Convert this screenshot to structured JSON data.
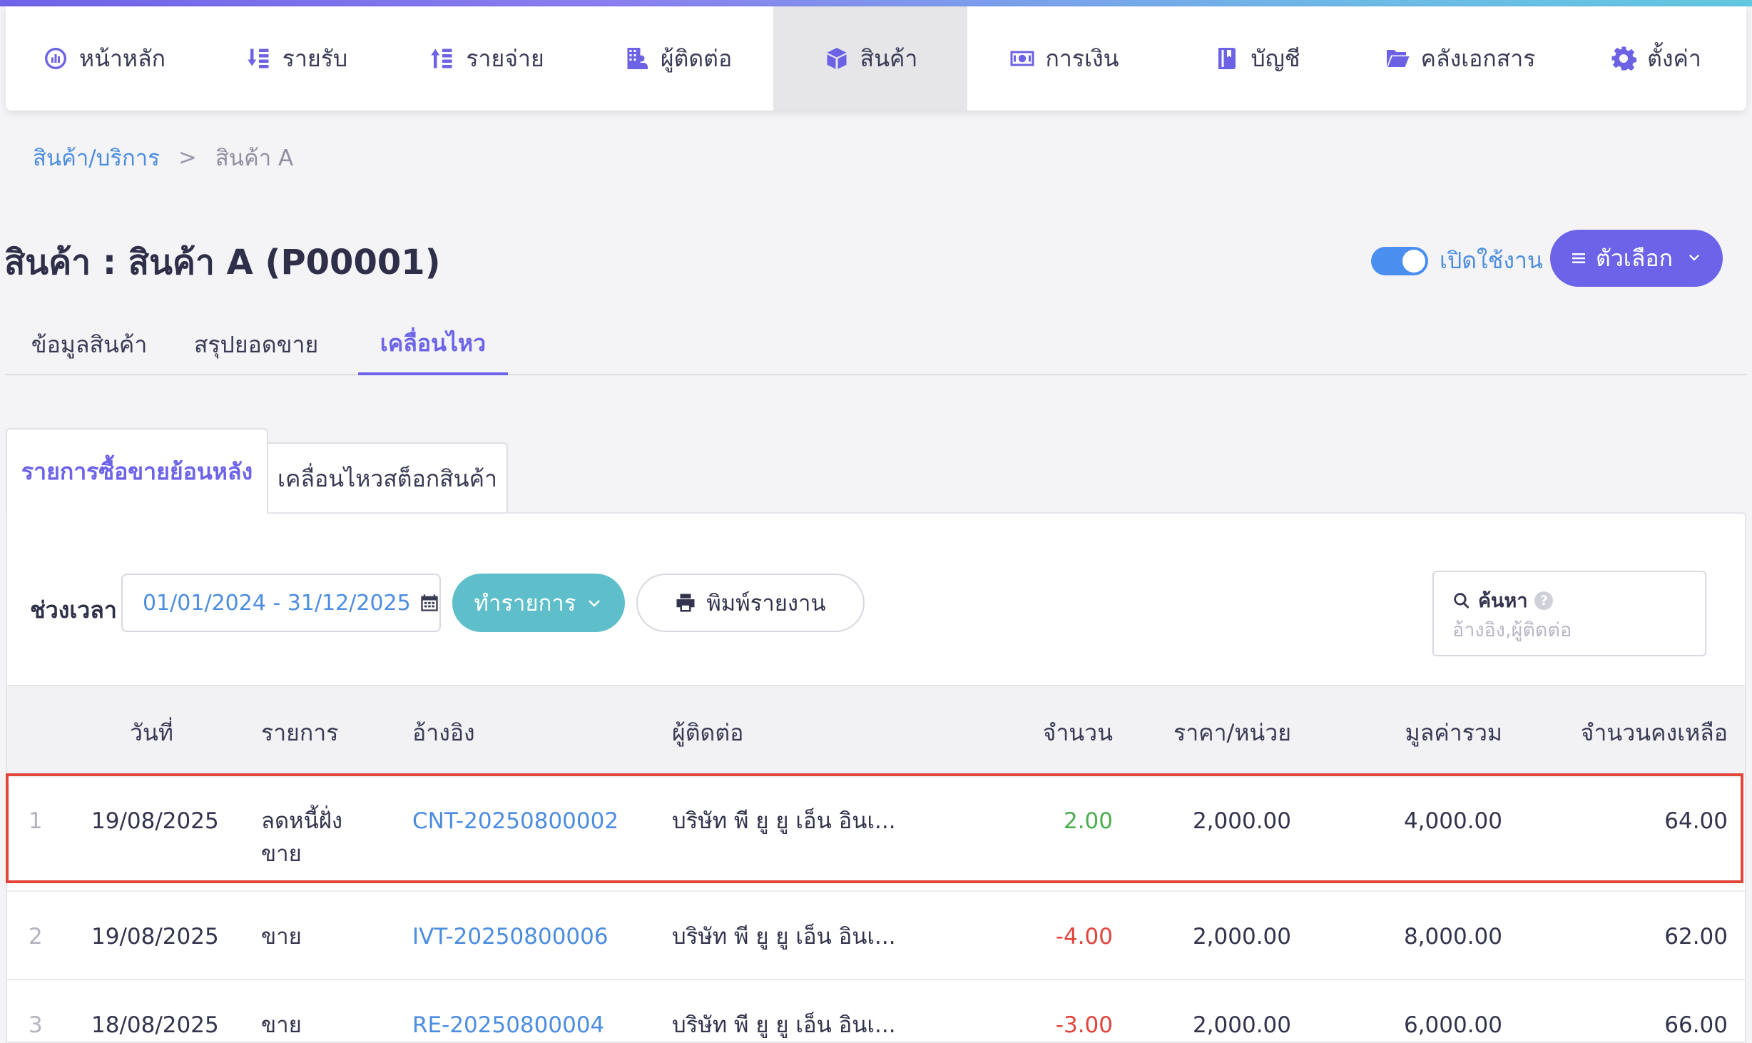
{
  "nav": {
    "items": [
      {
        "label": "หน้าหลัก",
        "icon": "dashboard-icon"
      },
      {
        "label": "รายรับ",
        "icon": "income-icon"
      },
      {
        "label": "รายจ่าย",
        "icon": "expense-icon"
      },
      {
        "label": "ผู้ติดต่อ",
        "icon": "contacts-icon"
      },
      {
        "label": "สินค้า",
        "icon": "box-icon",
        "active": true
      },
      {
        "label": "การเงิน",
        "icon": "money-icon"
      },
      {
        "label": "บัญชี",
        "icon": "ledger-icon"
      },
      {
        "label": "คลังเอกสาร",
        "icon": "folder-icon"
      },
      {
        "label": "ตั้งค่า",
        "icon": "gear-icon"
      }
    ]
  },
  "breadcrumb": {
    "parent": "สินค้า/บริการ",
    "separator": ">",
    "current": "สินค้า A"
  },
  "page": {
    "title": "สินค้า : สินค้า A (P00001)",
    "toggle_label": "เปิดใช้งาน",
    "toggle_on": true,
    "options_label": "ตัวเลือก"
  },
  "tabs": [
    {
      "label": "ข้อมูลสินค้า"
    },
    {
      "label": "สรุปยอดขาย"
    },
    {
      "label": "เคลื่อนไหว",
      "active": true
    }
  ],
  "subtabs": [
    {
      "label": "รายการซื้อขายย้อนหลัง",
      "active": true
    },
    {
      "label": "เคลื่อนไหวสต็อกสินค้า"
    }
  ],
  "filters": {
    "period_label": "ช่วงเวลา",
    "date_range": "01/01/2024 - 31/12/2025",
    "action_label": "ทำรายการ",
    "print_label": "พิมพ์รายงาน",
    "search_title": "ค้นหา",
    "search_help": "?",
    "search_placeholder": "อ้างอิง,ผู้ติดต่อ"
  },
  "table": {
    "columns": [
      "วันที่",
      "รายการ",
      "อ้างอิง",
      "ผู้ติดต่อ",
      "จำนวน",
      "ราคา/หน่วย",
      "มูลค่ารวม",
      "จำนวนคงเหลือ"
    ],
    "rows": [
      {
        "index": "1",
        "date": "19/08/2025",
        "type": "ลดหนี้ฝั่งขาย",
        "ref": "CNT-20250800002",
        "contact": "บริษัท พี ยู ยู เอ็น อินเ...",
        "qty": "2.00",
        "price": "2,000.00",
        "total": "4,000.00",
        "balance": "64.00",
        "highlighted": true
      },
      {
        "index": "2",
        "date": "19/08/2025",
        "type": "ขาย",
        "ref": "IVT-20250800006",
        "contact": "บริษัท พี ยู ยู เอ็น อินเ...",
        "qty": "-4.00",
        "price": "2,000.00",
        "total": "8,000.00",
        "balance": "62.00"
      },
      {
        "index": "3",
        "date": "18/08/2025",
        "type": "ขาย",
        "ref": "RE-20250800004",
        "contact": "บริษัท พี ยู ยู เอ็น อินเ...",
        "qty": "-3.00",
        "price": "2,000.00",
        "total": "6,000.00",
        "balance": "66.00"
      }
    ]
  },
  "colors": {
    "accent": "#6c63e8",
    "link": "#4c8de0",
    "teal_button": "#5ebfca",
    "positive": "#4caf50",
    "negative": "#e0443c",
    "highlight_border": "#e2463a"
  }
}
